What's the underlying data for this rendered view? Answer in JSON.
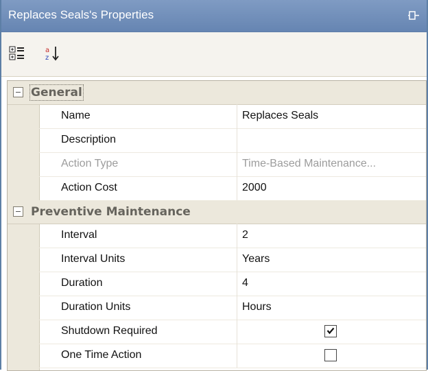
{
  "panel": {
    "title": "Replaces Seals's Properties",
    "pin_icon": "pin-icon",
    "toolbar": {
      "categorized_icon": "categorized-view-icon",
      "alphabetical_icon": "alphabetical-sort-icon"
    }
  },
  "categories": [
    {
      "label": "General",
      "rows": [
        {
          "name": "Name",
          "value": "Replaces Seals",
          "disabled": false
        },
        {
          "name": "Description",
          "value": "",
          "disabled": false
        },
        {
          "name": "Action Type",
          "value": "Time-Based Maintenance...",
          "disabled": true
        },
        {
          "name": "Action Cost",
          "value": "2000",
          "disabled": false
        }
      ]
    },
    {
      "label": "Preventive Maintenance",
      "rows": [
        {
          "name": "Interval",
          "value": "2",
          "disabled": false
        },
        {
          "name": "Interval Units",
          "value": "Years",
          "disabled": false
        },
        {
          "name": "Duration",
          "value": "4",
          "disabled": false
        },
        {
          "name": "Duration Units",
          "value": "Hours",
          "disabled": false
        },
        {
          "name": "Shutdown Required",
          "checked": true,
          "disabled": false
        },
        {
          "name": "One Time Action",
          "checked": false,
          "disabled": false
        }
      ]
    }
  ]
}
